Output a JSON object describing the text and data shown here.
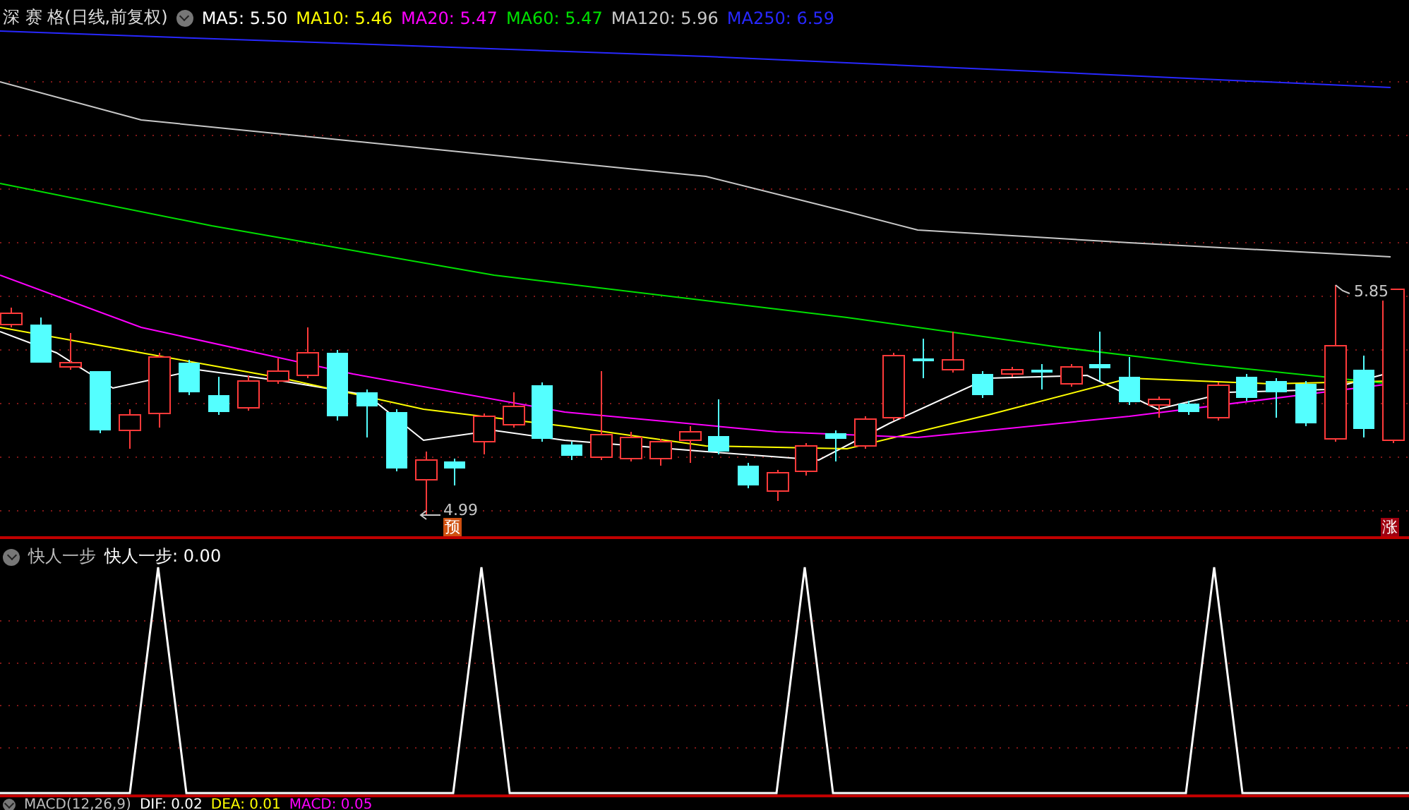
{
  "main_panel": {
    "title": "深 赛 格(日线,前复权)",
    "legend": [
      {
        "label": "MA5: 5.50",
        "color": "#ffffff"
      },
      {
        "label": "MA10: 5.46",
        "color": "#ffff00"
      },
      {
        "label": "MA20: 5.47",
        "color": "#ff00ff"
      },
      {
        "label": "MA60: 5.47",
        "color": "#00e000"
      },
      {
        "label": "MA120: 5.96",
        "color": "#c8c8c8"
      },
      {
        "label": "MA250: 6.59",
        "color": "#2828ff"
      }
    ],
    "high_marker": "5.85",
    "low_marker": "4.99",
    "badges": [
      {
        "kind": "forecast",
        "label": "预"
      },
      {
        "kind": "rise",
        "label": "涨"
      }
    ]
  },
  "indicator_panel": {
    "name": "快人一步",
    "legend": [
      {
        "label": "快人一步: 0.00",
        "color": "#ffffff"
      }
    ]
  },
  "macd_panel": {
    "name": "MACD(12,26,9)",
    "legend": [
      {
        "label": "DIF: 0.02",
        "color": "#ffffff"
      },
      {
        "label": "DEA: 0.01",
        "color": "#ffff00"
      },
      {
        "label": "MACD: 0.05",
        "color": "#ff00ff"
      }
    ]
  }
}
